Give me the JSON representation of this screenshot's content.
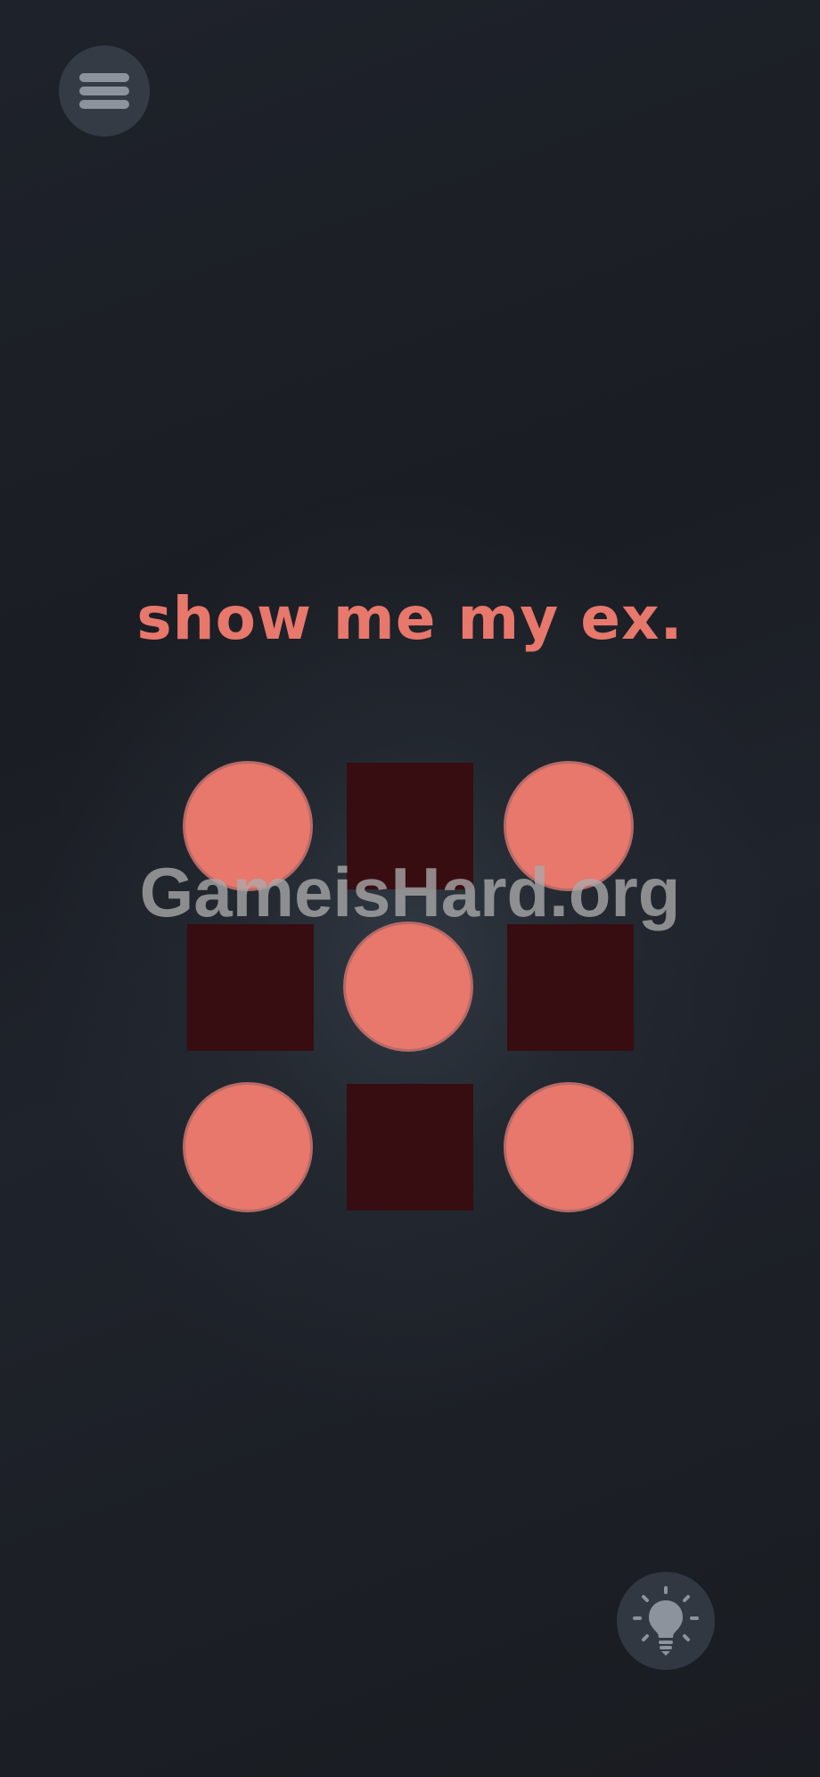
{
  "prompt": {
    "text": "show me my ex.",
    "color": "#e8776c"
  },
  "icons": {
    "menu": "hamburger-menu-icon",
    "hint": "lightbulb-icon"
  },
  "board": {
    "circle_color": "#e8776c",
    "square_color": "#370d12",
    "cells": [
      {
        "row": 1,
        "col": 1,
        "shape": "circle"
      },
      {
        "row": 1,
        "col": 2,
        "shape": "square"
      },
      {
        "row": 1,
        "col": 3,
        "shape": "circle"
      },
      {
        "row": 2,
        "col": 1,
        "shape": "square"
      },
      {
        "row": 2,
        "col": 2,
        "shape": "circle"
      },
      {
        "row": 2,
        "col": 3,
        "shape": "square"
      },
      {
        "row": 3,
        "col": 1,
        "shape": "circle"
      },
      {
        "row": 3,
        "col": 2,
        "shape": "square"
      },
      {
        "row": 3,
        "col": 3,
        "shape": "circle"
      }
    ]
  },
  "watermark": {
    "text": "GameisHard.org"
  }
}
